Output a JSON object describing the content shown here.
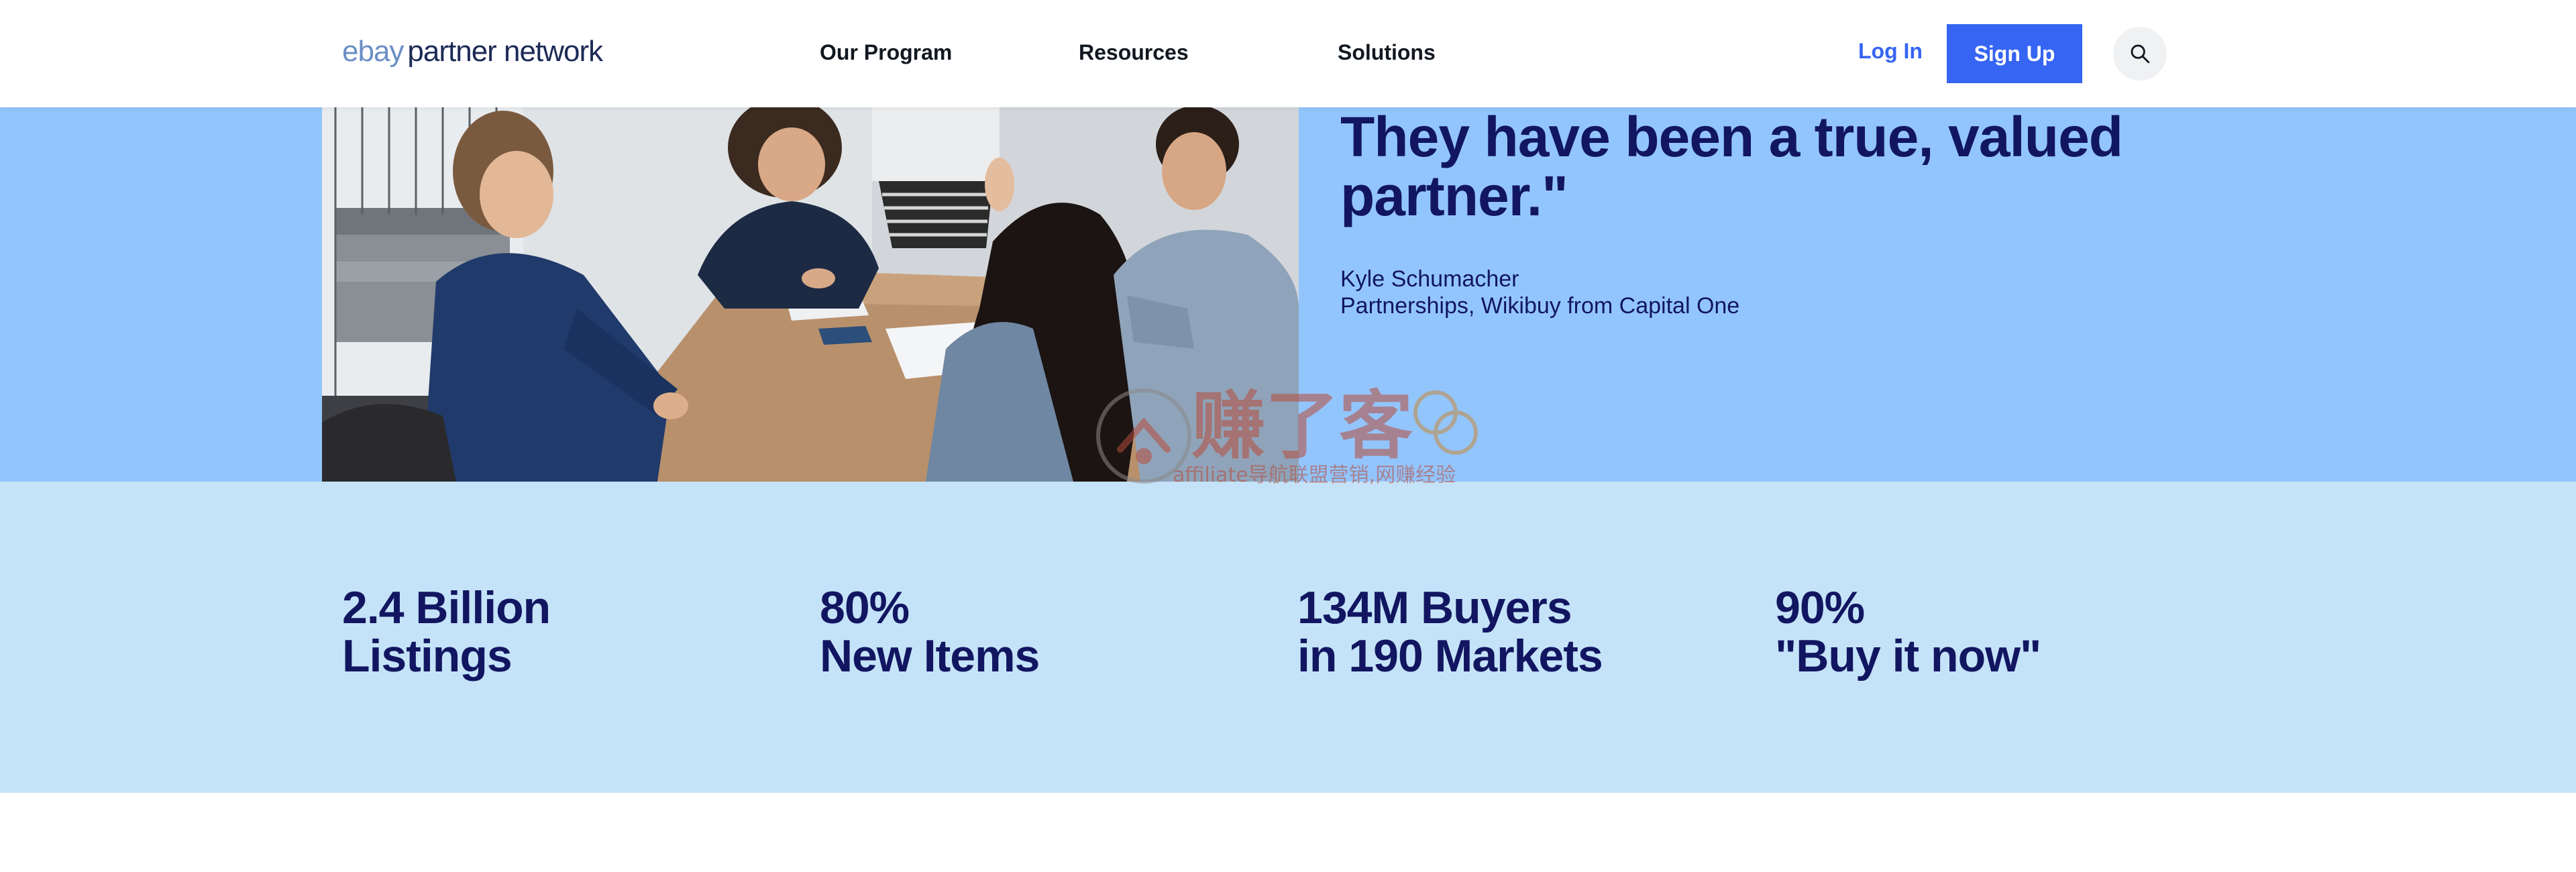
{
  "header": {
    "logo_brand": "ebay",
    "logo_rest": "partner network",
    "nav": [
      "Our Program",
      "Resources",
      "Solutions"
    ],
    "login_label": "Log In",
    "signup_label": "Sign Up",
    "search_icon": "search-icon"
  },
  "testimonial": {
    "quote_lines": [
      "They have been a true, valued",
      "partner.\""
    ],
    "author": "Kyle Schumacher",
    "author_role": "Partnerships, Wikibuy from Capital One"
  },
  "watermark": {
    "title": "赚了客",
    "subtitle": "affiliate导航联盟营销,网赚经验"
  },
  "stats": [
    {
      "line1": "2.4 Billion",
      "line2": "Listings"
    },
    {
      "line1": "80%",
      "line2": "New Items"
    },
    {
      "line1": "134M Buyers",
      "line2": "in 190 Markets"
    },
    {
      "line1": "90%",
      "line2": "\"Buy it now\""
    }
  ],
  "colors": {
    "accent": "#3665f3",
    "heading": "#121661",
    "testimonial_bg": "#93c5fd",
    "stats_bg": "#c5e3f8"
  }
}
